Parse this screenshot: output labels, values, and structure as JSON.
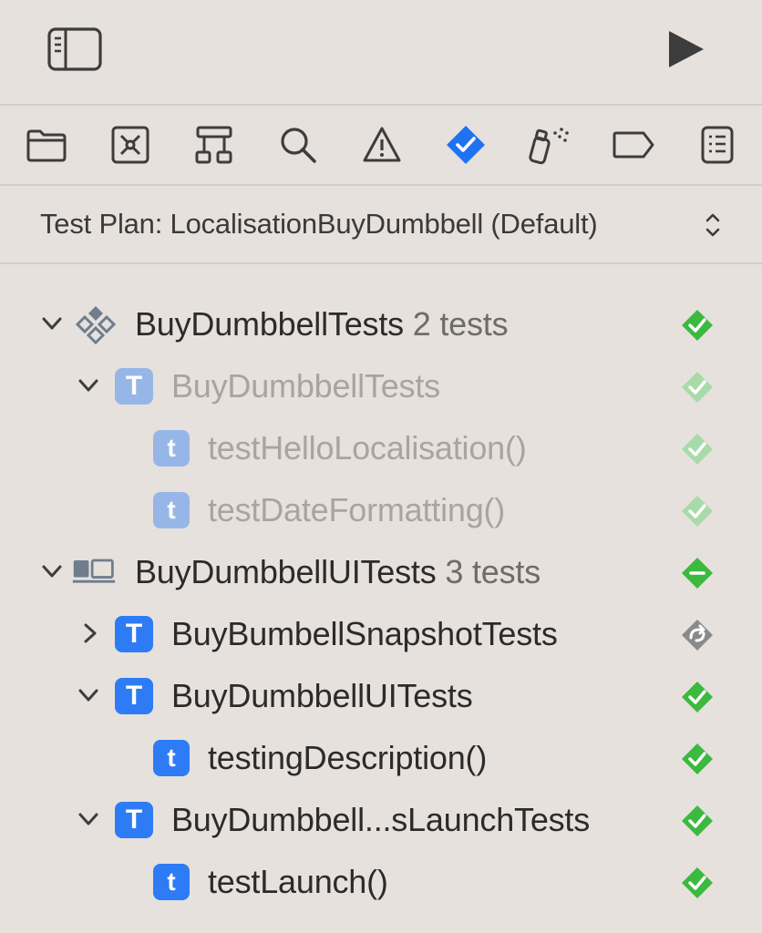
{
  "toolbar": {
    "sidebar_toggle_icon": "sidebar-left-icon",
    "run_icon": "play-icon"
  },
  "navigator_icons": [
    "folder-icon",
    "source-control-icon",
    "hierarchy-icon",
    "search-icon",
    "warning-icon",
    "test-icon",
    "debug-icon",
    "breakpoint-icon",
    "report-icon"
  ],
  "selected_navigator": "test-icon",
  "test_plan": {
    "label": "Test Plan: LocalisationBuyDumbbell (Default)"
  },
  "tree": {
    "bundle_unit": {
      "name": "BuyDumbbellTests",
      "count": "2 tests",
      "status": "passed"
    },
    "class_unit": {
      "name": "BuyDumbbellTests",
      "status": "passed-dim"
    },
    "test_hello": {
      "name": "testHelloLocalisation()",
      "status": "passed-dim"
    },
    "test_date": {
      "name": "testDateFormatting()",
      "status": "passed-dim"
    },
    "bundle_ui": {
      "name": "BuyDumbbellUITests",
      "count": "3 tests",
      "status": "partial"
    },
    "class_snapshot": {
      "name": "BuyBumbellSnapshotTests",
      "status": "skipped"
    },
    "class_ui": {
      "name": "BuyDumbbellUITests",
      "status": "passed"
    },
    "test_desc": {
      "name": "testingDescription()",
      "status": "passed"
    },
    "class_launch": {
      "name": "BuyDumbbell...sLaunchTests",
      "status": "passed"
    },
    "test_launch": {
      "name": "testLaunch()",
      "status": "passed"
    },
    "class_glyph": "T",
    "method_glyph": "t"
  },
  "colors": {
    "accent": "#2e7bf6",
    "pass": "#3cb93f",
    "pass_dim": "#a8dba9",
    "skipped": "#8a8a8a"
  }
}
